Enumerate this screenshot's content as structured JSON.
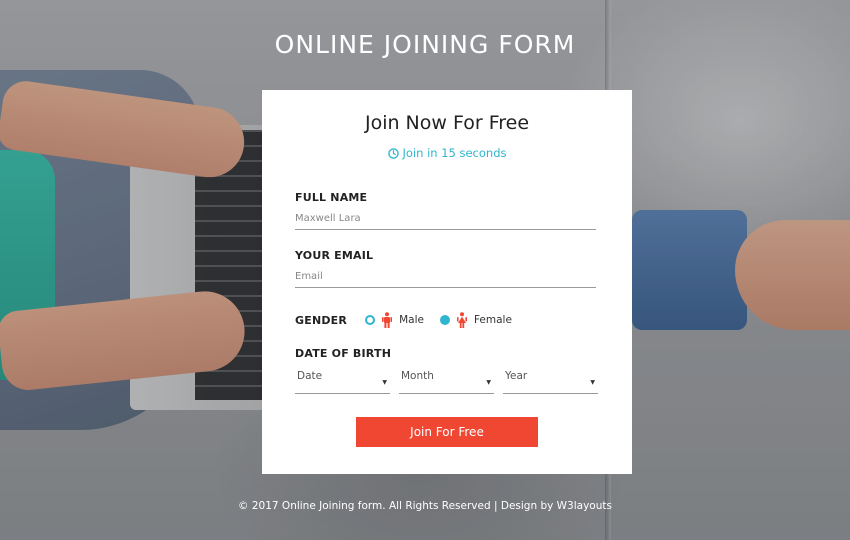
{
  "page": {
    "title": "ONLINE JOINING FORM"
  },
  "form": {
    "title": "Join Now For Free",
    "subtitle": "Join in 15 seconds",
    "full_name_label": "FULL NAME",
    "full_name_placeholder": "Maxwell Lara",
    "email_label": "YOUR EMAIL",
    "email_placeholder": "Email",
    "gender_label": "GENDER",
    "gender_options": [
      {
        "label": "Male",
        "selected": false
      },
      {
        "label": "Female",
        "selected": true
      }
    ],
    "dob_label": "DATE OF BIRTH",
    "dob_selects": {
      "date": "Date",
      "month": "Month",
      "year": "Year"
    },
    "submit_label": "Join For Free"
  },
  "footer": {
    "text": "© 2017 Online Joining form. All Rights Reserved | Design by W3layouts"
  },
  "colors": {
    "accent": "#2fb5cf",
    "button": "#f04733",
    "gender_icon": "#f04733"
  },
  "icons": {
    "subtitle": "clock-icon",
    "male": "male-icon",
    "female": "female-icon",
    "select_caret": "caret-down-icon"
  }
}
